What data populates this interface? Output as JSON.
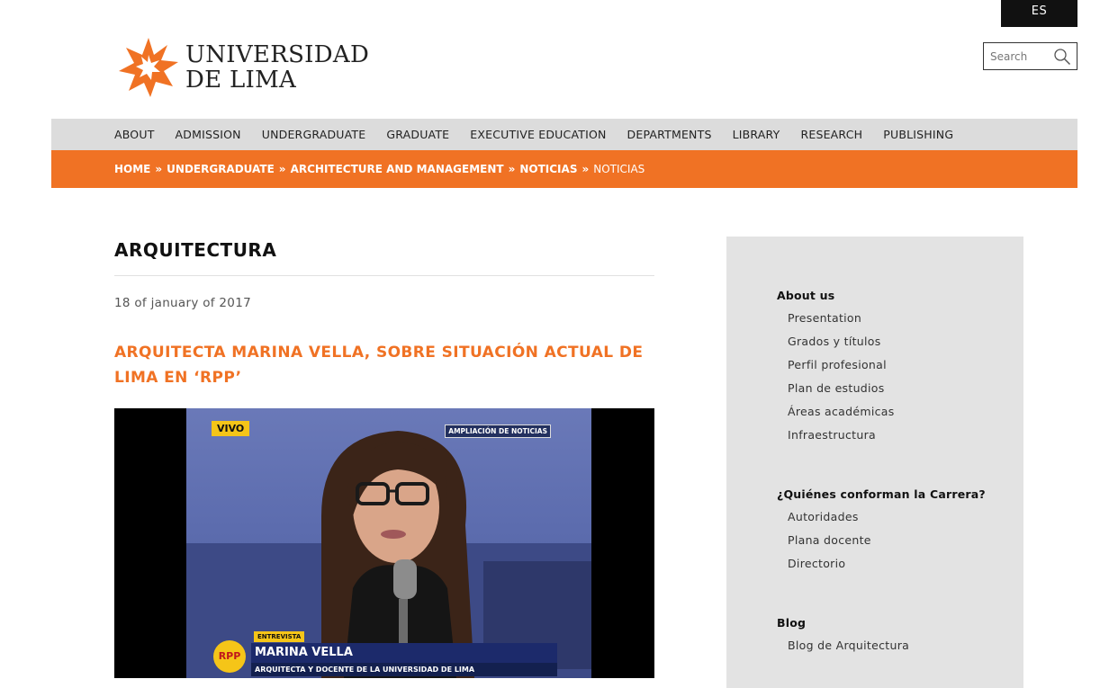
{
  "header": {
    "language_button": "ES",
    "logo": {
      "line1": "UNIVERSIDAD",
      "line2": "DE LIMA"
    },
    "search": {
      "placeholder": "Search"
    }
  },
  "nav": {
    "items": [
      "ABOUT",
      "ADMISSION",
      "UNDERGRADUATE",
      "GRADUATE",
      "EXECUTIVE EDUCATION",
      "DEPARTMENTS",
      "LIBRARY",
      "RESEARCH",
      "PUBLISHING"
    ]
  },
  "breadcrumb": {
    "items": [
      "HOME",
      "UNDERGRADUATE",
      "ARCHITECTURE AND MANAGEMENT",
      "NOTICIAS"
    ],
    "current": "NOTICIAS",
    "separator": "»"
  },
  "main": {
    "section_title": "ARQUITECTURA",
    "date": "18 of january of 2017",
    "headline": "ARQUITECTA MARINA VELLA, SOBRE SITUACIÓN ACTUAL DE LIMA EN ‘RPP’"
  },
  "video": {
    "live_badge": "VIVO",
    "program_logo": "AMPLIACIÓN DE NOTICIAS",
    "segment_tag": "ENTREVISTA",
    "channel_logo": "RPP",
    "guest_name": "MARINA VELLA",
    "guest_title": "ARQUITECTA Y DOCENTE DE LA UNIVERSIDAD DE LIMA"
  },
  "sidebar": {
    "groups": [
      {
        "title": "About us",
        "items": [
          "Presentation",
          "Grados y títulos",
          "Perfil profesional",
          "Plan de estudios",
          "Áreas académicas",
          "Infraestructura"
        ]
      },
      {
        "title": "¿Quiénes conforman la Carrera?",
        "items": [
          "Autoridades",
          "Plana docente",
          "Directorio"
        ]
      },
      {
        "title": "Blog",
        "items": [
          "Blog de Arquitectura"
        ]
      }
    ]
  },
  "colors": {
    "accent_orange": "#f07224",
    "nav_gray": "#dcdcdc",
    "sidebar_gray": "#e3e3e3",
    "lang_button_black": "#111111"
  }
}
